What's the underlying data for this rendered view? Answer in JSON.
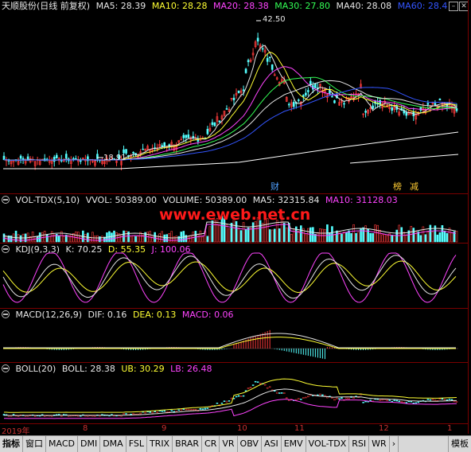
{
  "main": {
    "title": "天顺股份(日线 前复权)",
    "ma": [
      {
        "label": "MA5: 28.39",
        "color": "#e6e6e6"
      },
      {
        "label": "MA10: 28.28",
        "color": "#ffff33"
      },
      {
        "label": "MA20: 28.38",
        "color": "#ff44ff"
      },
      {
        "label": "MA30: 27.80",
        "color": "#33ff55"
      },
      {
        "label": "MA40: 28.08",
        "color": "#e6e6e6"
      },
      {
        "label": "MA60: 28.4",
        "color": "#3355ff"
      }
    ],
    "high_label": "42.50",
    "low_label": "18.91",
    "marker_cai": "财",
    "marker_bang": "榜",
    "marker_jian": "减"
  },
  "vol": {
    "name": "VOL-TDX(5,10)",
    "vvol": "VVOL: 50389.00",
    "volume": "VOLUME: 50389.00",
    "ma5": "MA5: 32315.84",
    "ma10": "MA10: 31128.03"
  },
  "kdj": {
    "name": "KDJ(9,3,3)",
    "k": "K: 70.25",
    "d": "D: 55.35",
    "j": "J: 100.06"
  },
  "macd": {
    "name": "MACD(12,26,9)",
    "dif": "DIF: 0.16",
    "dea": "DEA: 0.13",
    "macd": "MACD: 0.06"
  },
  "boll": {
    "name": "BOLL(20)",
    "boll": "BOLL: 28.38",
    "ub": "UB: 30.29",
    "lb": "LB: 26.48"
  },
  "watermark": "www.eweb.net.cn",
  "time_axis": [
    "2019年",
    "8",
    "9",
    "10",
    "11",
    "12",
    "1"
  ],
  "tabs": [
    "指标",
    "窗口",
    "MACD",
    "DMI",
    "DMA",
    "FSL",
    "TRIX",
    "BRAR",
    "CR",
    "VR",
    "OBV",
    "ASI",
    "EMV",
    "VOL-TDX",
    "RSI",
    "WR",
    "›",
    "模板"
  ],
  "colors": {
    "up": "#ff3c3c",
    "down": "#54ffff",
    "bg": "#000000",
    "grid": "#7a0000"
  }
}
